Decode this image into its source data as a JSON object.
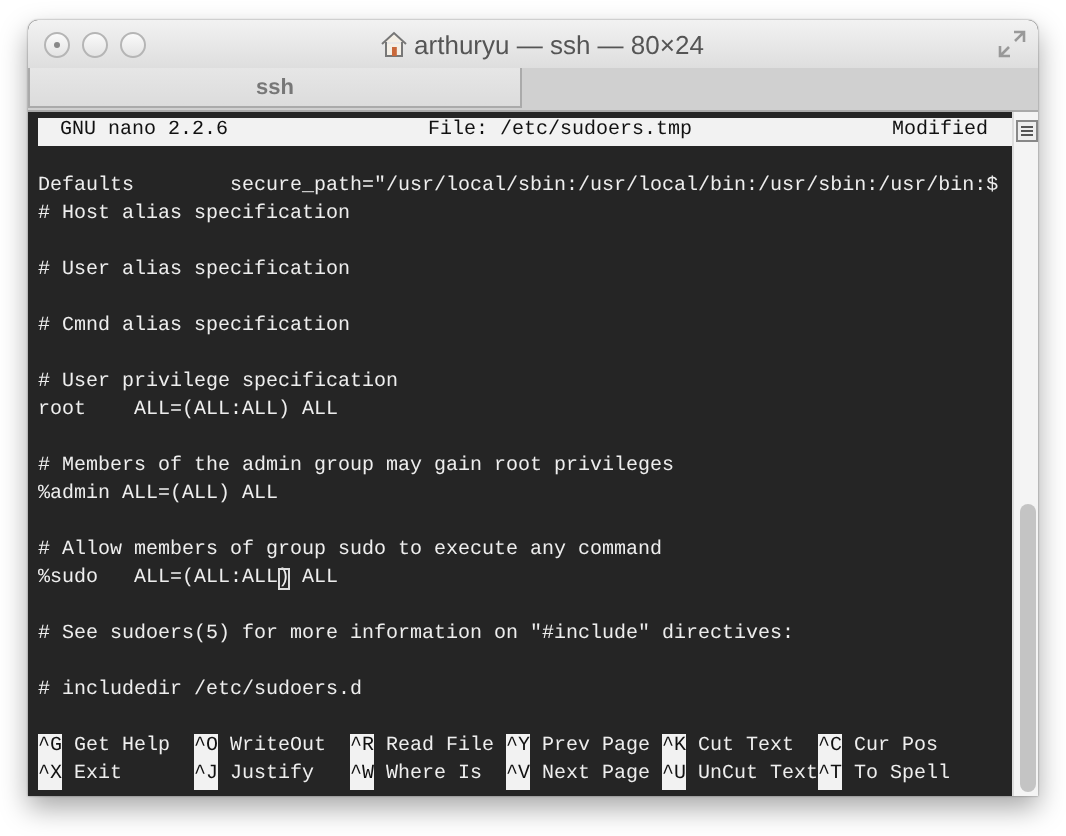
{
  "window": {
    "title": "arthuryu — ssh — 80×24"
  },
  "tabs": [
    {
      "label": "ssh",
      "selected": true
    }
  ],
  "nano": {
    "version": "GNU nano 2.2.6",
    "file": "File: /etc/sudoers.tmp",
    "status": "Modified"
  },
  "blocks": [
    {
      "lines": [
        {
          "text": "Defaults        secure_path=\"/usr/local/sbin:/usr/local/bin:/usr/sbin:/usr/bin:$"
        },
        {
          "text": "# Host alias specification"
        }
      ]
    },
    {
      "lines": [
        {
          "text": "# User alias specification"
        }
      ]
    },
    {
      "lines": [
        {
          "text": "# Cmnd alias specification"
        }
      ]
    },
    {
      "lines": [
        {
          "text": "# User privilege specification"
        },
        {
          "text": "root    ALL=(ALL:ALL) ALL"
        }
      ]
    },
    {
      "lines": [
        {
          "text": "# Members of the admin group may gain root privileges"
        },
        {
          "text": "%admin ALL=(ALL) ALL"
        }
      ]
    },
    {
      "lines": [
        {
          "text": "# Allow members of group sudo to execute any command"
        },
        {
          "text": "%sudo   ALL=(ALL:ALL",
          "cursor": ")",
          "text_after": " ALL"
        }
      ]
    },
    {
      "lines": [
        {
          "text": "# See sudoers(5) for more information on \"#include\" directives:"
        }
      ]
    },
    {
      "lines": [
        {
          "text": "# includedir /etc/sudoers.d"
        }
      ]
    }
  ],
  "shortcuts": [
    {
      "key": "^G",
      "label": "Get Help"
    },
    {
      "key": "^O",
      "label": "WriteOut"
    },
    {
      "key": "^R",
      "label": "Read File"
    },
    {
      "key": "^Y",
      "label": "Prev Page"
    },
    {
      "key": "^K",
      "label": "Cut Text"
    },
    {
      "key": "^C",
      "label": "Cur Pos"
    },
    {
      "key": "^X",
      "label": "Exit"
    },
    {
      "key": "^J",
      "label": "Justify"
    },
    {
      "key": "^W",
      "label": "Where Is"
    },
    {
      "key": "^V",
      "label": "Next Page"
    },
    {
      "key": "^U",
      "label": "UnCut Text"
    },
    {
      "key": "^T",
      "label": "To Spell"
    }
  ],
  "scrollbar": {
    "level": 0.45
  }
}
